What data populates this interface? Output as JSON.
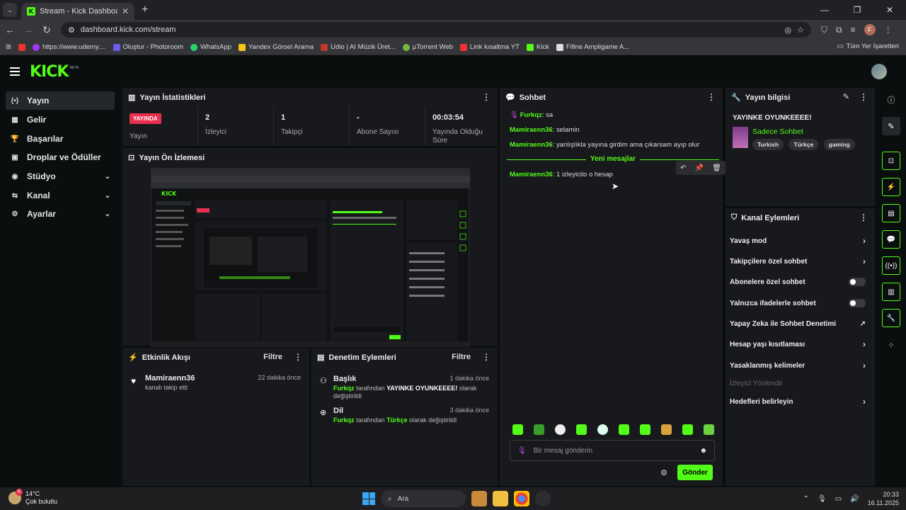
{
  "browser": {
    "tab_title": "Stream - Kick Dashboard",
    "url": "dashboard.kick.com/stream",
    "bookmarks": [
      "https://www.udemy....",
      "Oluştur - Photoroom",
      "WhatsApp",
      "Yandex Görsel Arama",
      "Udio | AI Müzik Üret...",
      "µTorrent Web",
      "Link kısaltma YT",
      "Kick",
      "Fifine Ampligame A..."
    ],
    "bookmarks_right": "Tüm Yer İşaretleri",
    "profile_initial": "F"
  },
  "app": {
    "logo": "KICK",
    "beta": "BETA"
  },
  "nav": {
    "items": [
      {
        "label": "Yayın",
        "icon": "(•)"
      },
      {
        "label": "Gelir",
        "icon": "▦"
      },
      {
        "label": "Başarılar",
        "icon": "🏆"
      },
      {
        "label": "Droplar ve Ödüller",
        "icon": "▣"
      },
      {
        "label": "Stüdyo",
        "icon": "◉"
      },
      {
        "label": "Kanal",
        "icon": "⇆"
      },
      {
        "label": "Ayarlar",
        "icon": "⚙"
      }
    ]
  },
  "stats": {
    "title": "Yayın İstatistikleri",
    "live_badge": "YAYINDA",
    "items": [
      {
        "value": "",
        "label": "Yayın"
      },
      {
        "value": "2",
        "label": "İzleyici"
      },
      {
        "value": "1",
        "label": "Takipçi"
      },
      {
        "value": "-",
        "label": "Abone Sayısı"
      },
      {
        "value": "00:03:54",
        "label": "Yayında Olduğu Süre"
      }
    ]
  },
  "preview": {
    "title": "Yayın Ön İzlemesi"
  },
  "activity": {
    "title": "Etkinlik Akışı",
    "filter": "Filtre",
    "items": [
      {
        "name": "Mamiraenn36",
        "sub": "kanalı takip etti",
        "time": "22 dakika önce"
      }
    ]
  },
  "moderation": {
    "title": "Denetim Eylemleri",
    "filter": "Filtre",
    "items": [
      {
        "title": "Başlık",
        "time": "1 dakika önce",
        "user": "Furkqz",
        "mid": " tarafından ",
        "value": "YAYINKE OYUNKEEEE!",
        "end": " olarak değiştirildi"
      },
      {
        "title": "Dil",
        "time": "3 dakika önce",
        "user": "Furkqz",
        "mid": " tarafından ",
        "value": "Türkçe",
        "end": " olarak değiştirildi"
      }
    ]
  },
  "chat": {
    "title": "Sohbet",
    "messages": [
      {
        "user": "Furkqz",
        "text": "sa"
      },
      {
        "user": "Mamiraenn36",
        "text": "selamin"
      },
      {
        "user": "Mamiraenn36",
        "text": "yanlışlıkla yayına girdim ama çıkarsam ayıp olur"
      },
      {
        "user": "Mamiraenn36",
        "text": "1 izleyicilo o hesap"
      }
    ],
    "new_messages": "Yeni mesajlar",
    "input_placeholder": "Bir mesaj gönderin",
    "send": "Gönder"
  },
  "stream_info": {
    "title": "Yayın bilgisi",
    "stream_title": "YAYINKE OYUNKEEEE!",
    "category": "Sadece Sohbet",
    "tags": [
      "Turkish",
      "Türkçe",
      "gaming"
    ]
  },
  "channel_actions": {
    "title": "Kanal Eylemleri",
    "items": [
      {
        "label": "Yavaş mod",
        "kind": "arrow"
      },
      {
        "label": "Takipçilere özel sohbet",
        "kind": "arrow"
      },
      {
        "label": "Abonelere özel sohbet",
        "kind": "toggle"
      },
      {
        "label": "Yalnızca ifadelerle sohbet",
        "kind": "toggle"
      },
      {
        "label": "Yapay Zeka ile Sohbet Denetimi",
        "kind": "external"
      },
      {
        "label": "Hesap yaşı kısıtlaması",
        "kind": "arrow"
      },
      {
        "label": "Yasaklanmış kelimeler",
        "kind": "arrow"
      },
      {
        "label": "İzleyici Yönlendir",
        "kind": "disabled"
      },
      {
        "label": "Hedefleri belirleyin",
        "kind": "arrow"
      }
    ]
  },
  "taskbar": {
    "temp": "14°C",
    "weather": "Çok bulutlu",
    "weather_badge": "6",
    "search": "Ara",
    "time": "20:33",
    "date": "16.11.2025"
  },
  "colors": {
    "accent": "#53fc18",
    "live": "#e7304e",
    "panel": "#18191c",
    "bg": "#0b0e0f"
  }
}
